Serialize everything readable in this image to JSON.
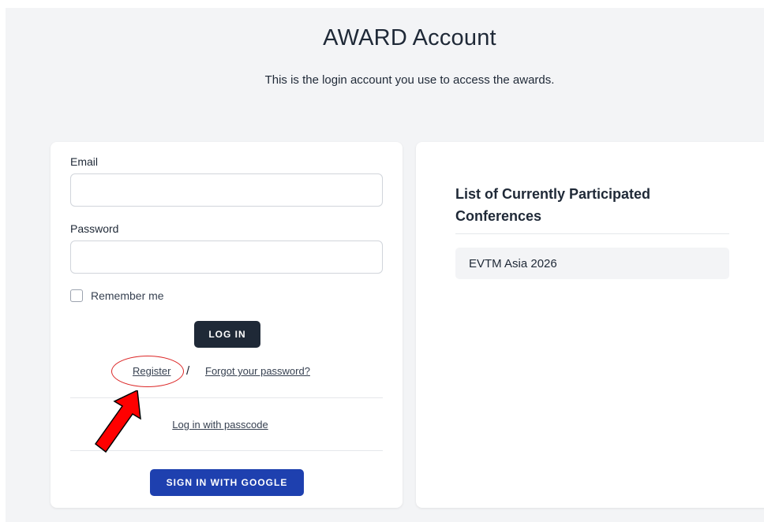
{
  "header": {
    "title": "AWARD Account",
    "subtitle": "This is the login account you use to access the awards."
  },
  "login_form": {
    "email_label": "Email",
    "email_value": "",
    "password_label": "Password",
    "password_value": "",
    "remember_label": "Remember me",
    "remember_checked": false,
    "login_button": "LOG IN",
    "register_link": "Register",
    "separator": "/",
    "forgot_link": "Forgot your password?",
    "passcode_link": "Log in with passcode",
    "google_button": "SIGN IN WITH GOOGLE"
  },
  "conferences": {
    "title": "List of Currently Participated Conferences",
    "items": [
      "EVTM Asia 2026"
    ]
  },
  "annotations": {
    "circle_color": "#dc2626",
    "arrow_color": "#ff0000"
  },
  "colors": {
    "background": "#f3f4f6",
    "login_button": "#1f2937",
    "google_button": "#1e40af"
  }
}
